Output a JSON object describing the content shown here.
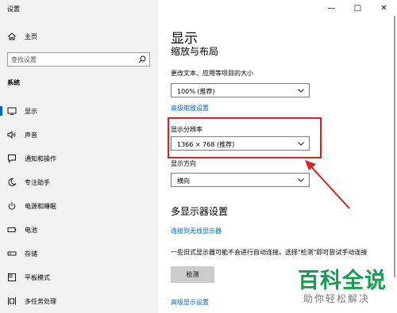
{
  "app": {
    "title": "设置"
  },
  "window_controls": {
    "minimize": "—",
    "maximize": "□",
    "close": "✕"
  },
  "sidebar": {
    "home_label": "主页",
    "search_placeholder": "查找设置",
    "section": "系统",
    "items": [
      {
        "label": "显示",
        "icon": "monitor-icon",
        "active": true
      },
      {
        "label": "声音",
        "icon": "speaker-icon"
      },
      {
        "label": "通知和操作",
        "icon": "notification-icon"
      },
      {
        "label": "专注助手",
        "icon": "moon-icon"
      },
      {
        "label": "电源和睡眠",
        "icon": "power-icon"
      },
      {
        "label": "电池",
        "icon": "battery-icon"
      },
      {
        "label": "存储",
        "icon": "storage-icon"
      },
      {
        "label": "平板模式",
        "icon": "tablet-icon"
      },
      {
        "label": "多任务处理",
        "icon": "multitask-icon"
      }
    ]
  },
  "main": {
    "title": "显示",
    "scale_section": "缩放与布局",
    "scale_label": "更改文本、应用等项目的大小",
    "scale_value": "100% (推荐)",
    "advanced_scale_link": "高级缩放设置",
    "resolution_label": "显示分辨率",
    "resolution_value": "1366 × 768 (推荐)",
    "orientation_label": "显示方向",
    "orientation_value": "横向",
    "multi_section": "多显示器设置",
    "wireless_link": "连接到无线显示器",
    "detect_desc": "一些旧式显示器可能不会进行自动连接。选择\"检测\"即可尝试手动连接",
    "detect_button": "检测",
    "advanced_display_link": "高级显示设置"
  },
  "annotation": {
    "color": "#e0201e"
  },
  "accent_color": "#0067c0",
  "watermark": {
    "main": "百科全说",
    "sub": "助你轻松解决",
    "color": "#13a04e"
  }
}
